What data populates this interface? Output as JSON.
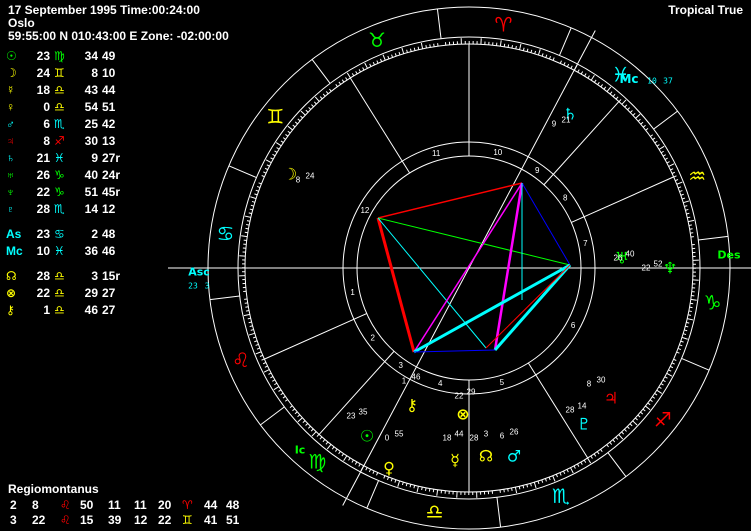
{
  "header": {
    "date_line": "17 September 1995 Time:00:24:00",
    "place": "Oslo",
    "coords": "59:55:00 N 010:43:00 E Zone: -02:00:00",
    "zodiac": "Tropical True"
  },
  "colors": {
    "fire": "#ff0000",
    "earth": "#00ff00",
    "air": "#ffff00",
    "water": "#00ffff",
    "white": "#ffffff",
    "magenta": "#ff00ff",
    "blue": "#0000ff"
  },
  "planets": [
    {
      "name": "Sun",
      "glyph": "☉",
      "color": "#00ff00",
      "deg": "23",
      "sign_glyph": "♍",
      "sign_color": "#00ff00",
      "min": "34",
      "sec": "49"
    },
    {
      "name": "Moon",
      "glyph": "☽",
      "color": "#ffff00",
      "deg": "24",
      "sign_glyph": "♊",
      "sign_color": "#ffff00",
      "min": "8",
      "sec": "10"
    },
    {
      "name": "Mercury",
      "glyph": "☿",
      "color": "#ffff00",
      "deg": "18",
      "sign_glyph": "♎",
      "sign_color": "#ffff00",
      "min": "43",
      "sec": "44"
    },
    {
      "name": "Venus",
      "glyph": "♀",
      "color": "#ffff00",
      "deg": "0",
      "sign_glyph": "♎",
      "sign_color": "#ffff00",
      "min": "54",
      "sec": "51"
    },
    {
      "name": "Mars",
      "glyph": "♂",
      "color": "#00ffff",
      "deg": "6",
      "sign_glyph": "♏",
      "sign_color": "#00ffff",
      "min": "25",
      "sec": "42"
    },
    {
      "name": "Jupiter",
      "glyph": "♃",
      "color": "#ff0000",
      "deg": "8",
      "sign_glyph": "♐",
      "sign_color": "#ff0000",
      "min": "30",
      "sec": "13"
    },
    {
      "name": "Saturn",
      "glyph": "♄",
      "color": "#00ffff",
      "deg": "21",
      "sign_glyph": "♓",
      "sign_color": "#00ffff",
      "min": "9",
      "sec": "27r"
    },
    {
      "name": "Uranus",
      "glyph": "♅",
      "color": "#00ff00",
      "deg": "26",
      "sign_glyph": "♑",
      "sign_color": "#00ff00",
      "min": "40",
      "sec": "24r"
    },
    {
      "name": "Neptune",
      "glyph": "♆",
      "color": "#00ff00",
      "deg": "22",
      "sign_glyph": "♑",
      "sign_color": "#00ff00",
      "min": "51",
      "sec": "45r"
    },
    {
      "name": "Pluto",
      "glyph": "♇",
      "color": "#00ffff",
      "deg": "28",
      "sign_glyph": "♏",
      "sign_color": "#00ffff",
      "min": "14",
      "sec": "12"
    },
    {
      "name": "Ascendant",
      "glyph": "As",
      "color": "#00ffff",
      "deg": "23",
      "sign_glyph": "♋",
      "sign_color": "#00ffff",
      "min": "2",
      "sec": "48"
    },
    {
      "name": "Midheaven",
      "glyph": "Mc",
      "color": "#00ffff",
      "deg": "10",
      "sign_glyph": "♓",
      "sign_color": "#00ffff",
      "min": "36",
      "sec": "46"
    },
    {
      "name": "Node",
      "glyph": "☊",
      "color": "#ffff00",
      "deg": "28",
      "sign_glyph": "♎",
      "sign_color": "#ffff00",
      "min": "3",
      "sec": "15r"
    },
    {
      "name": "Fortune",
      "glyph": "⊗",
      "color": "#ffff00",
      "deg": "22",
      "sign_glyph": "♎",
      "sign_color": "#ffff00",
      "min": "29",
      "sec": "27"
    },
    {
      "name": "Chiron",
      "glyph": "⚷",
      "color": "#ffff00",
      "deg": "1",
      "sign_glyph": "♎",
      "sign_color": "#ffff00",
      "min": "46",
      "sec": "27"
    }
  ],
  "house_system": {
    "title": "Regiomontanus",
    "rows": [
      {
        "h1": "2",
        "d1": "8",
        "s1": "♌",
        "s1c": "#ff0000",
        "m1": "50",
        "h2": "11",
        "d2": "11",
        "m2": "20",
        "s2": "♈",
        "s2c": "#ff0000",
        "x2": "44",
        "y2": "48"
      },
      {
        "h1": "3",
        "d1": "22",
        "s1": "♌",
        "s1c": "#ff0000",
        "m1": "15",
        "h2": "39",
        "d2": "12",
        "m2": "22",
        "s2": "♊",
        "s2c": "#ffff00",
        "x2": "41",
        "y2": "51"
      }
    ]
  },
  "wheel": {
    "zodiac_signs": [
      {
        "glyph": "♈",
        "color": "#ff0000",
        "label": "aries"
      },
      {
        "glyph": "♉",
        "color": "#00ff00",
        "label": "taurus"
      },
      {
        "glyph": "♊",
        "color": "#ffff00",
        "label": "gemini"
      },
      {
        "glyph": "♋",
        "color": "#00ffff",
        "label": "cancer"
      },
      {
        "glyph": "♌",
        "color": "#ff0000",
        "label": "leo"
      },
      {
        "glyph": "♍",
        "color": "#00ff00",
        "label": "virgo"
      },
      {
        "glyph": "♎",
        "color": "#ffff00",
        "label": "libra"
      },
      {
        "glyph": "♏",
        "color": "#00ffff",
        "label": "scorpio"
      },
      {
        "glyph": "♐",
        "color": "#ff0000",
        "label": "sagittarius"
      },
      {
        "glyph": "♑",
        "color": "#00ff00",
        "label": "capricorn"
      },
      {
        "glyph": "♒",
        "color": "#ffff00",
        "label": "aquarius"
      },
      {
        "glyph": "♓",
        "color": "#00ffff",
        "label": "pisces"
      }
    ],
    "house_numbers": [
      "1",
      "2",
      "3",
      "4",
      "5",
      "6",
      "7",
      "8",
      "9",
      "10",
      "11",
      "12"
    ],
    "angles": {
      "asc_label": "Asc",
      "asc_pos": "23",
      "asc_pos2": "3",
      "des_label": "Des",
      "mc_label": "Mc",
      "mc_pos": "10",
      "mc_pos2": "37",
      "ic_label": "Ic"
    },
    "planet_labels": [
      {
        "glyph": "♄",
        "color": "#00ffff",
        "deg": "21",
        "min": "9"
      },
      {
        "glyph": "☽",
        "color": "#ffff00",
        "deg": "24",
        "min": "8"
      },
      {
        "glyph": "♅",
        "color": "#00ff00",
        "deg": "40",
        "min": "26"
      },
      {
        "glyph": "♆",
        "color": "#00ff00",
        "deg": "52",
        "min": "22"
      },
      {
        "glyph": "♃",
        "color": "#ff0000",
        "deg": "30",
        "min": "8"
      },
      {
        "glyph": "♇",
        "color": "#00ffff",
        "deg": "14",
        "min": "28"
      },
      {
        "glyph": "♂",
        "color": "#00ffff",
        "deg": "26",
        "min": "6"
      },
      {
        "glyph": "☊",
        "color": "#ffff00",
        "deg": "3",
        "min": "28"
      },
      {
        "glyph": "☿",
        "color": "#ffff00",
        "deg": "44",
        "min": "18"
      },
      {
        "glyph": "⊗",
        "color": "#ffff00",
        "deg": "29",
        "min": "22"
      },
      {
        "glyph": "⚷",
        "color": "#ffff00",
        "deg": "46",
        "min": "1"
      },
      {
        "glyph": "☉",
        "color": "#00ff00",
        "deg": "35",
        "min": "23"
      },
      {
        "glyph": "♀",
        "color": "#ffff00",
        "deg": "55",
        "min": "0"
      }
    ]
  }
}
